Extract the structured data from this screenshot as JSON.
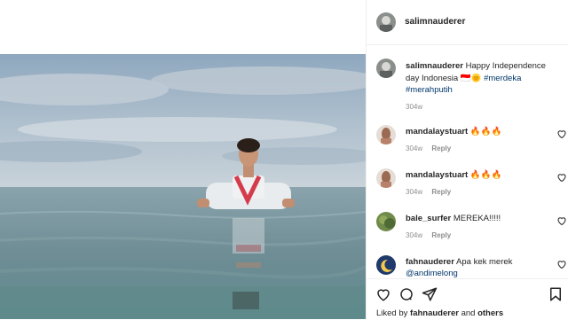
{
  "post": {
    "username": "salimnauderer",
    "caption": {
      "username": "salimnauderer",
      "text": "Happy Independence day Indonesia 🇮🇩🌞",
      "hashtag1": "#merdeka",
      "hashtag2": "#merahputih",
      "age": "304w"
    },
    "comments": [
      {
        "username": "mandalaystuart",
        "text": "🔥🔥🔥",
        "age": "304w",
        "reply": "Reply"
      },
      {
        "username": "mandalaystuart",
        "text": "🔥🔥🔥",
        "age": "304w",
        "reply": "Reply"
      },
      {
        "username": "bale_surfer",
        "text": "MEREKA!!!!!",
        "age": "304w",
        "reply": "Reply"
      },
      {
        "username": "fahnauderer",
        "text": "Apa kek merek",
        "mention": "@andimelong"
      }
    ],
    "likes": {
      "prefix": "Liked by",
      "user": "fahnauderer",
      "joiner": "and",
      "others": "others"
    }
  },
  "icons": [
    "heart-icon",
    "comment-icon",
    "share-icon",
    "bookmark-icon"
  ],
  "colors": {
    "link": "#00376b",
    "muted": "#8e8e8e",
    "text": "#262626",
    "border": "#efefef"
  }
}
